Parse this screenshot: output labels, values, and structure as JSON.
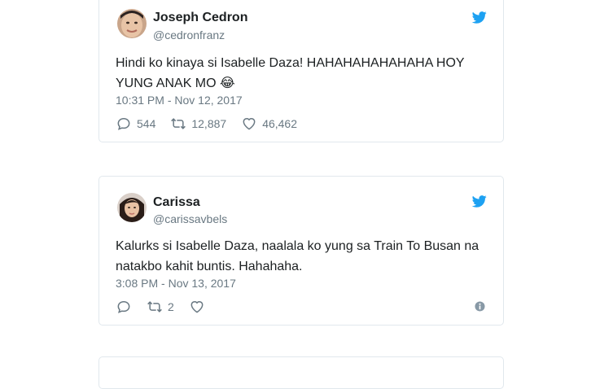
{
  "tweets": [
    {
      "author_name": "Joseph Cedron",
      "author_handle": "@cedronfranz",
      "text_line1": "Hindi ko kinaya si Isabelle Daza! HAHAHAHAHAHAHA HOY",
      "text_line2": "YUNG ANAK MO",
      "emoji": "😂",
      "timestamp": "10:31 PM - Nov 12, 2017",
      "replies": "544",
      "retweets": "12,887",
      "likes": "46,462"
    },
    {
      "author_name": "Carissa",
      "author_handle": "@carissavbels",
      "text_line1": "Kalurks si Isabelle Daza, naalala ko yung sa Train To Busan na",
      "text_line2": "natakbo kahit buntis. Hahahaha.",
      "timestamp": "3:08 PM - Nov 13, 2017",
      "replies": "",
      "retweets": "2",
      "likes": ""
    }
  ],
  "icons": {
    "twitter_bird": "twitter-bird-icon",
    "reply": "reply-icon",
    "retweet": "retweet-icon",
    "like": "heart-icon",
    "info": "info-icon"
  },
  "colors": {
    "twitter_blue": "#1da1f2",
    "text_primary": "#1c2022",
    "text_secondary": "#697882",
    "border": "#e1e8ed"
  }
}
